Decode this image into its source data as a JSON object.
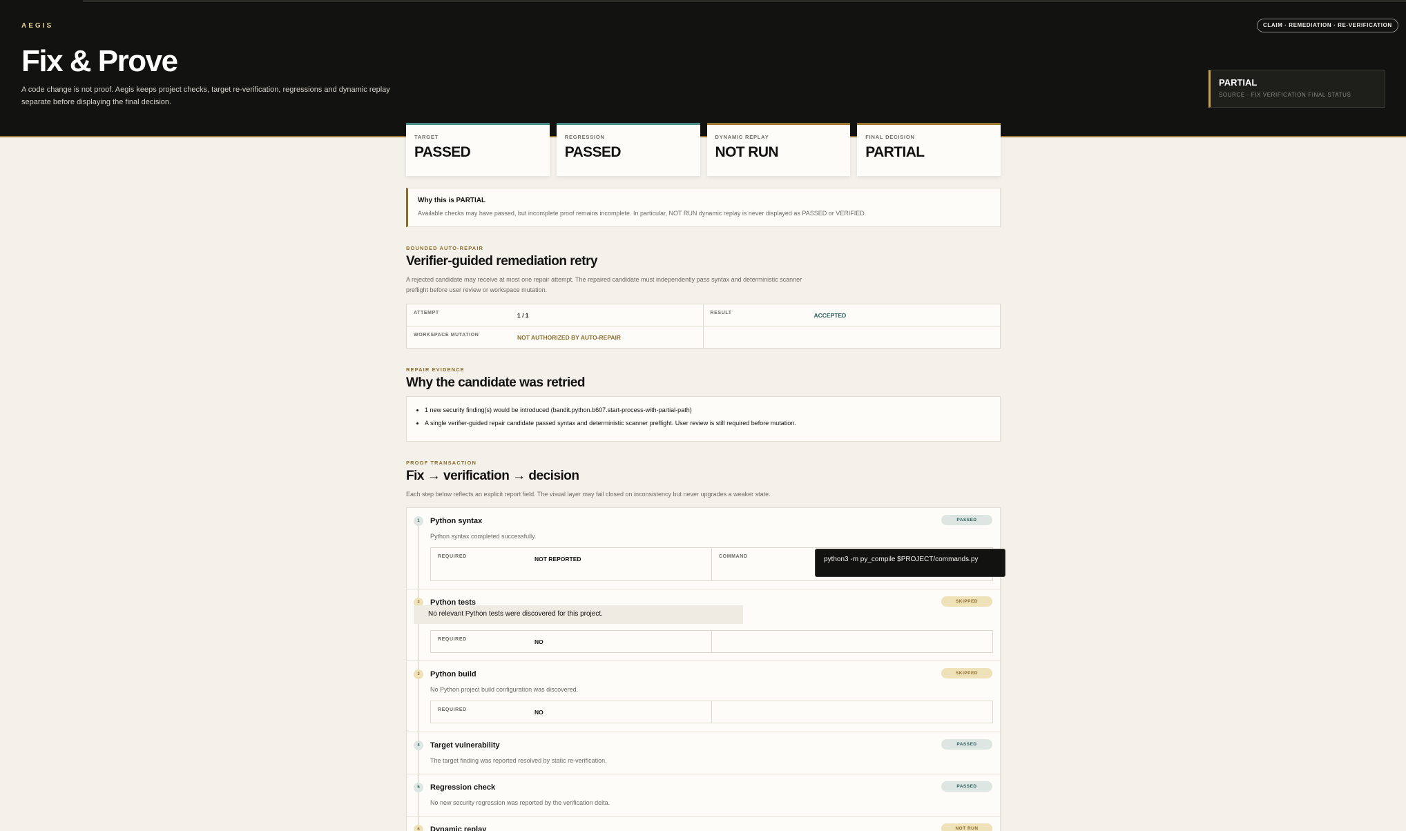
{
  "header": {
    "brand": "AEGIS",
    "title": "Fix & Prove",
    "subtitle": "A code change is not proof. Aegis keeps project checks, target re-verification, regressions and dynamic replay separate before displaying the final decision.",
    "pill": "CLAIM · REMEDIATION · RE-VERIFICATION",
    "status": "PARTIAL",
    "status_source": "SOURCE · FIX VERIFICATION FINAL STATUS"
  },
  "summary": [
    {
      "label": "TARGET",
      "value": "PASSED"
    },
    {
      "label": "REGRESSION",
      "value": "PASSED"
    },
    {
      "label": "DYNAMIC REPLAY",
      "value": "NOT RUN"
    },
    {
      "label": "FINAL DECISION",
      "value": "PARTIAL"
    }
  ],
  "why": {
    "heading": "Why this is PARTIAL",
    "text": "Available checks may have passed, but incomplete proof remains incomplete. In particular, NOT RUN dynamic replay is never displayed as PASSED or VERIFIED."
  },
  "repair": {
    "eyebrow": "BOUNDED AUTO-REPAIR",
    "title": "Verifier-guided remediation retry",
    "description": "A rejected candidate may receive at most one repair attempt. The repaired candidate must independently pass syntax and deterministic scanner preflight before user review or workspace mutation.",
    "attempt_label": "ATTEMPT",
    "attempt_value": "1 / 1",
    "result_label": "RESULT",
    "result_value": "ACCEPTED",
    "mutation_label": "WORKSPACE MUTATION",
    "mutation_value": "NOT AUTHORIZED BY AUTO-REPAIR"
  },
  "evidence": {
    "eyebrow": "REPAIR EVIDENCE",
    "title": "Why the candidate was retried",
    "items": [
      "1 new security finding(s) would be introduced (bandit.python.b607.start-process-with-partial-path)",
      "A single verifier-guided repair candidate passed syntax and deterministic scanner preflight. User review is still required before mutation."
    ]
  },
  "proof": {
    "eyebrow": "PROOF TRANSACTION",
    "title": "Fix → verification → decision",
    "description": "Each step below reflects an explicit report field. The visual layer may fail closed on inconsistency but never upgrades a weaker state."
  },
  "steps": [
    {
      "num": "1",
      "name": "Python syntax",
      "note": "Python syntax completed successfully.",
      "badge": "PASSED",
      "required_label": "REQUIRED",
      "required_value": "NOT REPORTED",
      "command_label": "COMMAND"
    },
    {
      "num": "2",
      "name": "Python tests",
      "note": "No relevant Python tests were discovered for this project.",
      "badge": "SKIPPED",
      "required_label": "REQUIRED",
      "required_value": "NO"
    },
    {
      "num": "3",
      "name": "Python build",
      "note": "No Python project build configuration was discovered.",
      "badge": "SKIPPED",
      "required_label": "REQUIRED",
      "required_value": "NO"
    },
    {
      "num": "4",
      "name": "Target vulnerability",
      "note": "The target finding was reported resolved by static re-verification.",
      "badge": "PASSED"
    },
    {
      "num": "5",
      "name": "Regression check",
      "note": "No new security regression was reported by the verification delta.",
      "badge": "PASSED"
    },
    {
      "num": "6",
      "name": "Dynamic replay",
      "badge": "NOT RUN"
    }
  ],
  "tooltip": {
    "command": "python3 -m py_compile $PROJECT/commands.py"
  },
  "colors": {
    "header_bg": "#121210",
    "accent_gold": "#9a7a35",
    "passed_teal": "#2f5e5a",
    "skipped_amber": "#8a6d2c"
  }
}
